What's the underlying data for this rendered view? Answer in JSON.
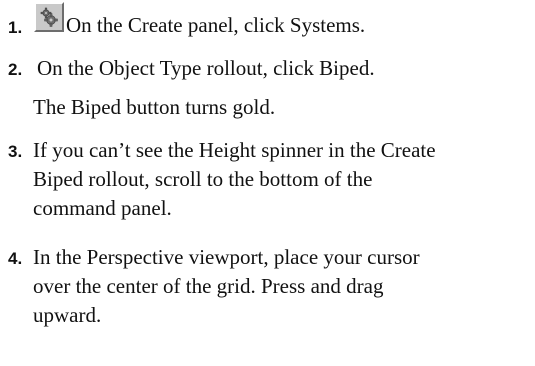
{
  "steps": [
    {
      "number": "1.",
      "icon": "systems-gears-icon",
      "lines": [
        "On the Create panel, click Systems."
      ]
    },
    {
      "number": "2.",
      "lines": [
        "On the Object Type rollout, click Biped."
      ]
    },
    {
      "note": "The Biped button turns gold."
    },
    {
      "number": "3.",
      "lines": [
        "If you can’t see the Height spinner in the Create",
        "Biped rollout, scroll to the bottom of the",
        "command panel."
      ]
    },
    {
      "number": "4.",
      "lines": [
        "In the Perspective viewport, place your cursor",
        "over the center of the grid.  Press and drag",
        "upward."
      ]
    }
  ],
  "colors": {
    "text": "#111111",
    "icon_face": "#c9c9c9",
    "gear": "#6e6e6e"
  }
}
